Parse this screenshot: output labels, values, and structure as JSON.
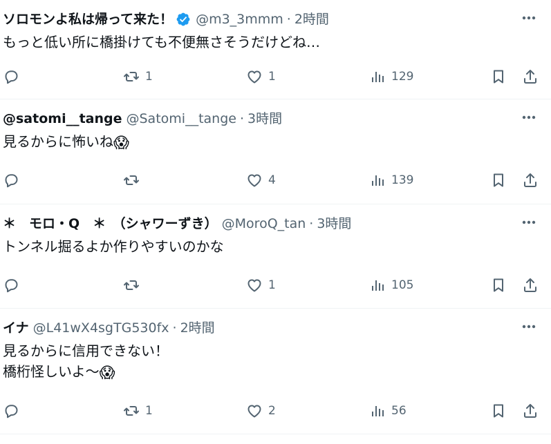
{
  "tweets": [
    {
      "name": "ソロモンよ私は帰って来た！",
      "verified": true,
      "handle": "@m3_3mmm",
      "time": "2時間",
      "text": "もっと低い所に橋掛けても不便無さそうだけどね…",
      "emoji": "",
      "text2": "",
      "replies": "",
      "retweets": "1",
      "likes": "1",
      "views": "129"
    },
    {
      "name": "@satomi__tange",
      "verified": false,
      "handle": "@Satomi__tange",
      "time": "3時間",
      "text": "見るからに怖いね",
      "emoji": "😱",
      "text2": "",
      "replies": "",
      "retweets": "",
      "likes": "4",
      "views": "139"
    },
    {
      "name": "＊　モロ・Q　＊　（シャワーずき）",
      "verified": false,
      "handle": "@MoroQ_tan",
      "time": "3時間",
      "text": "トンネル掘るよか作りやすいのかな",
      "emoji": "",
      "text2": "",
      "replies": "",
      "retweets": "",
      "likes": "1",
      "views": "105"
    },
    {
      "name": "イナ",
      "verified": false,
      "handle": "@L41wX4sgTG530fx",
      "time": "2時間",
      "text": "見るからに信用できない！\n橋桁怪しいよ〜",
      "emoji": "😱",
      "text2": "",
      "replies": "",
      "retweets": "1",
      "likes": "2",
      "views": "56"
    }
  ],
  "separator": "·",
  "colors": {
    "text": "#0f1419",
    "secondary": "#536471",
    "verified_badge": "#1d9bf0",
    "border": "#eff3f4"
  },
  "icons": {
    "more": "more-dots-icon",
    "reply": "reply-bubble-icon",
    "retweet": "retweet-arrows-icon",
    "like": "heart-icon",
    "views": "bar-chart-icon",
    "bookmark": "bookmark-icon",
    "share": "share-upload-icon",
    "verified": "verified-badge-icon"
  }
}
